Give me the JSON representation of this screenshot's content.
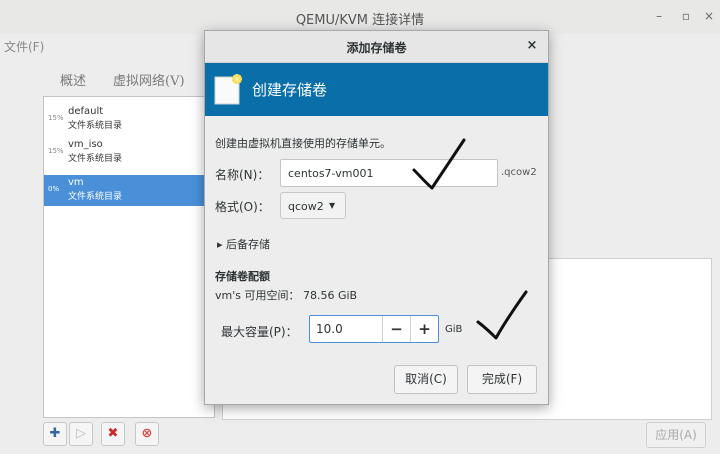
{
  "main_window": {
    "title": "QEMU/KVM 连接详情",
    "controls": {
      "minimize": "–",
      "maximize": "▫",
      "close": "×"
    },
    "menu": {
      "file": "文件(F)"
    },
    "tabs": {
      "overview": "概述",
      "virtual_networks": "虚拟网络(V)"
    },
    "pools": [
      {
        "percent": "15%",
        "name": "default",
        "type": "文件系统目录",
        "selected": false
      },
      {
        "percent": "15%",
        "name": "vm_iso",
        "type": "文件系统目录",
        "selected": false
      },
      {
        "percent": "0%",
        "name": "vm",
        "type": "文件系统目录",
        "selected": true
      }
    ],
    "toolbar_icons": [
      "add-icon",
      "play-icon",
      "delete-icon",
      "stop-icon"
    ],
    "apply_label": "应用(A)"
  },
  "dialog": {
    "title": "添加存储卷",
    "close": "×",
    "header": "创建存储卷",
    "header_color": "#0a6fa8",
    "description": "创建由虚拟机直接使用的存储单元。",
    "name_label": "名称(N)：",
    "name_value": "centos7-vm001",
    "name_suffix": ".qcow2",
    "format_label": "格式(O)：",
    "format_value": "qcow2",
    "backing_label": "后备存储",
    "quota_title": "存储卷配额",
    "avail_label": "vm's 可用空间：",
    "avail_value": "78.56 GiB",
    "capacity_label": "最大容量(P)：",
    "capacity_value": "10.0",
    "capacity_unit": "GiB",
    "cancel_label": "取消(C)",
    "finish_label": "完成(F)"
  }
}
